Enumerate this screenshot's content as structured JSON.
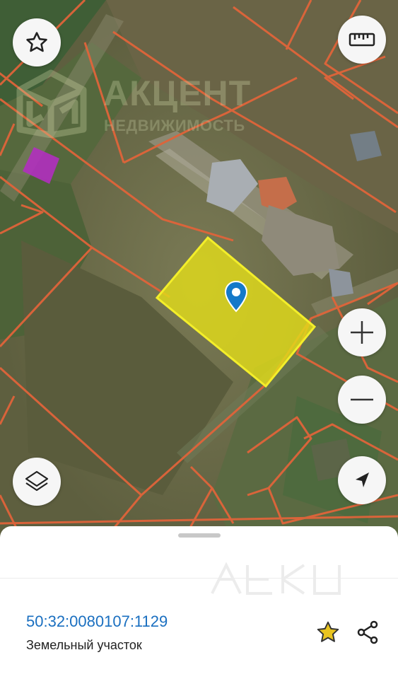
{
  "watermark": {
    "title": "АКЦЕНТ",
    "subtitle": "НЕДВИЖИМОСТЬ"
  },
  "map": {
    "favorite_button_icon": "star-outline-icon",
    "ruler_button_icon": "ruler-icon",
    "layers_button_icon": "layers-icon",
    "zoom_in_icon": "plus-icon",
    "zoom_out_icon": "minus-icon",
    "locate_icon": "navigation-arrow-icon",
    "marker_icon": "location-pin-icon",
    "colors": {
      "boundary": "#e0643a",
      "selected_plot_fill": "#e2dc1a",
      "selected_plot_border": "#f3ee2a",
      "other_plot": "#b12fbf",
      "marker": "#1479c9"
    }
  },
  "sheet": {
    "cadastral_number": "50:32:0080107:1129",
    "property_type": "Земельный участок",
    "favorite_icon": "star-icon",
    "share_icon": "share-icon",
    "colors": {
      "link": "#1a6fc0",
      "star": "#e9c41f"
    }
  }
}
